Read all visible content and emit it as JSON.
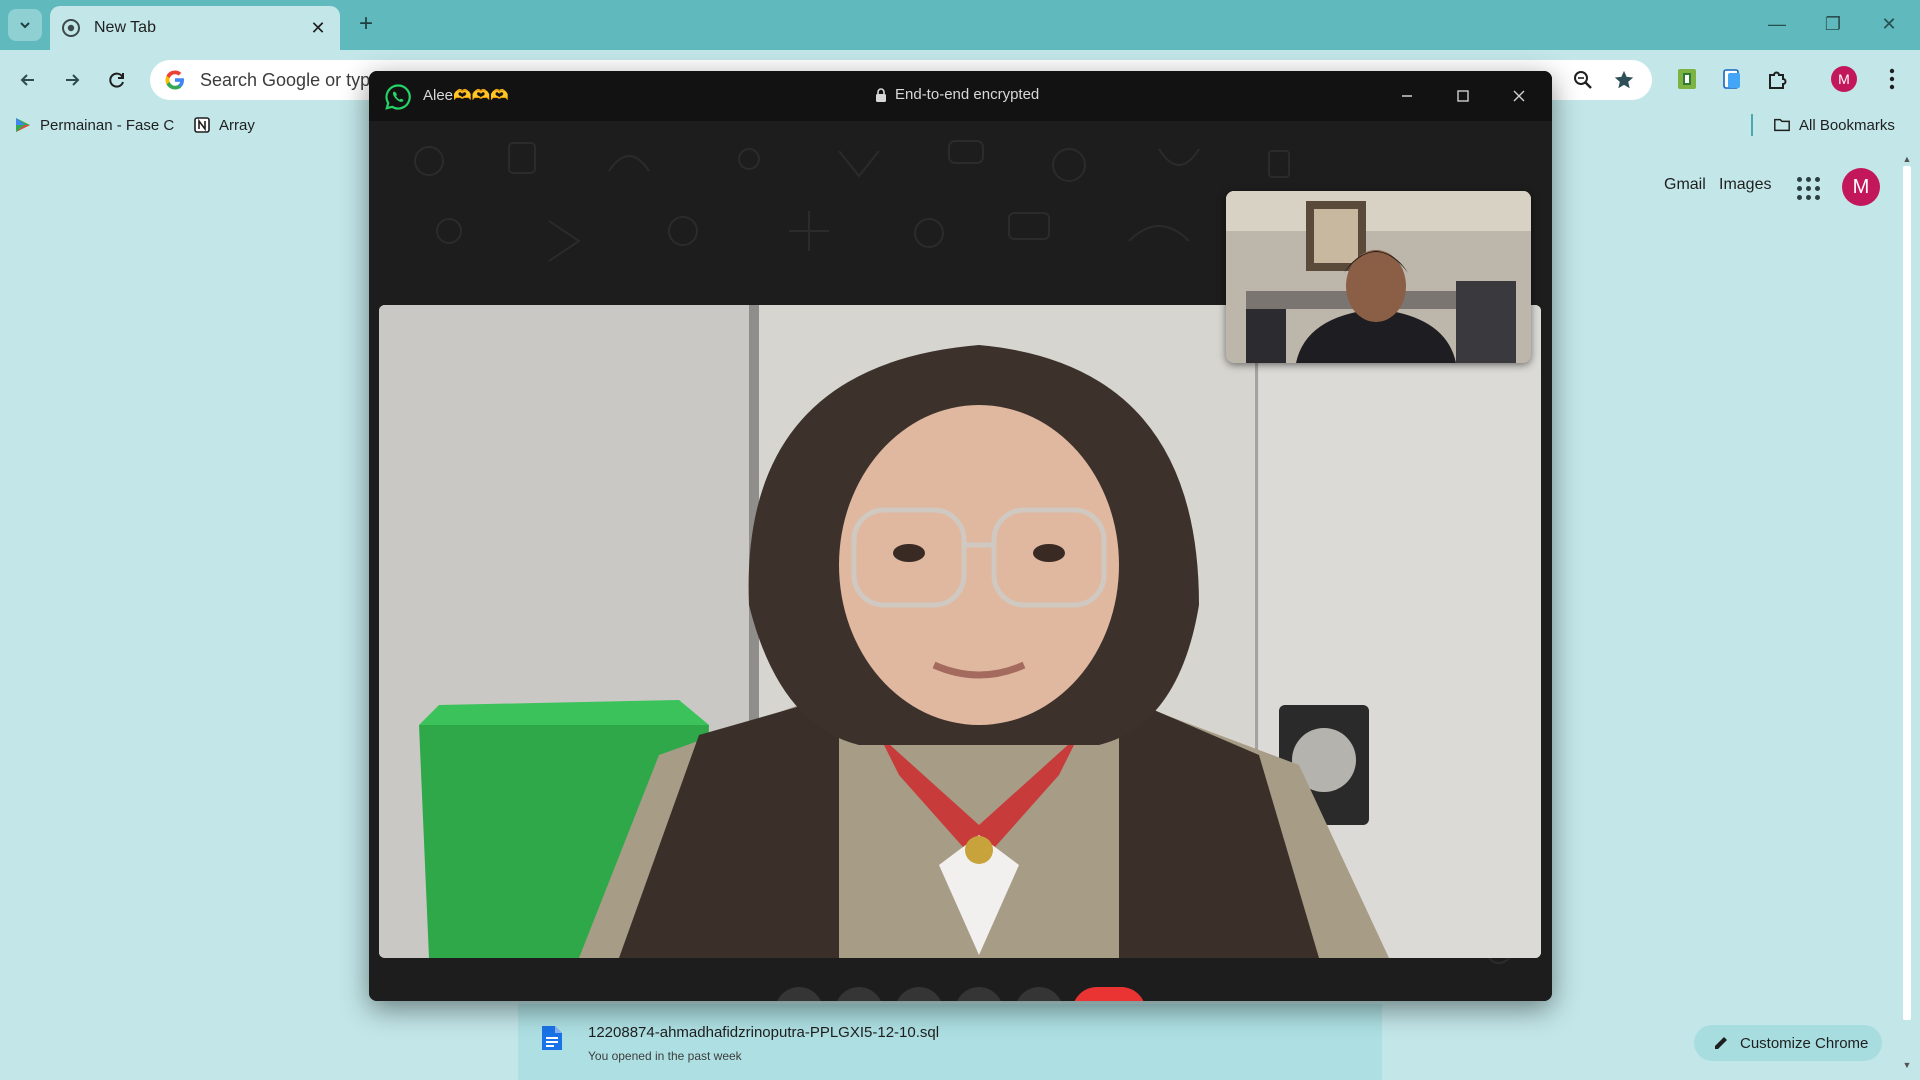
{
  "browser": {
    "tab": {
      "title": "New Tab",
      "close_glyph": "✕"
    },
    "new_tab_glyph": "+",
    "window_controls": {
      "minimize_glyph": "—",
      "restore_glyph": "❐",
      "close_glyph": "✕"
    },
    "omnibox": {
      "placeholder": "Search Google or type a URL"
    },
    "bookmarks": [
      {
        "label": "Permainan - Fase C",
        "icon": "play-games-icon"
      },
      {
        "label": "Array",
        "icon": "notion-icon"
      }
    ],
    "all_bookmarks_label": "All Bookmarks"
  },
  "ntp": {
    "links": {
      "gmail": "Gmail",
      "images": "Images"
    },
    "profile_initial": "M",
    "recent_file": {
      "name": "12208874-ahmadhafidzrinoputra-PPLGXI5-12-10.sql",
      "subtitle": "You opened in the past week"
    },
    "customize_label": "Customize Chrome"
  },
  "whatsapp_call": {
    "contact_name": "Alee🫶🫶🫶",
    "encryption_label": "End-to-end encrypted",
    "buttons": [
      "add-participant",
      "share-screen",
      "camera",
      "microphone",
      "more-options",
      "end-call"
    ]
  },
  "colors": {
    "tabstrip": "#5fb9bd",
    "page_bg": "#c3e7e9",
    "whatsapp_green": "#25d366",
    "end_call_red": "#ea3434",
    "profile": "#c2185b"
  }
}
